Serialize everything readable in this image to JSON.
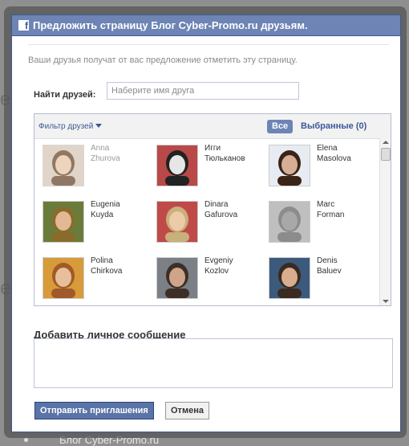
{
  "dialog": {
    "title": "Предложить страницу Блог Cyber-Promo.ru друзьям.",
    "intro": "Ваши друзья получат от вас предложение отметить эту страницу.",
    "find_label": "Найти друзей:",
    "find_placeholder": "Наберите имя друга",
    "filter_label": "Фильтр друзей",
    "tab_all": "Все",
    "tab_selected": "Выбранные (0)",
    "message_label": "Добавить личное сообщение",
    "send_button": "Отправить приглашения",
    "cancel_button": "Отмена"
  },
  "friends": [
    {
      "first": "Anna",
      "last": "Zhurova",
      "dim": true,
      "colors": {
        "bg": "#d8c8b8",
        "hair": "#6b4a2f",
        "face": "#e8c6a8"
      }
    },
    {
      "first": "Игги",
      "last": "Тюльканов",
      "colors": {
        "bg": "#b94848",
        "hair": "#222222",
        "face": "#e6e6e6"
      }
    },
    {
      "first": "Elena",
      "last": "Masolova",
      "colors": {
        "bg": "#e7ecf2",
        "hair": "#3a2418",
        "face": "#d6ae95"
      }
    },
    {
      "first": "Eugenia",
      "last": "Kuyda",
      "colors": {
        "bg": "#6b7c3a",
        "hair": "#8a6b2b",
        "face": "#e2b994"
      }
    },
    {
      "first": "Dinara",
      "last": "Gafurova",
      "colors": {
        "bg": "#c04a4a",
        "hair": "#c8b07a",
        "face": "#edcaa8"
      }
    },
    {
      "first": "Marc",
      "last": "Forman",
      "colors": {
        "bg": "#bfbfbf",
        "hair": "#8c8c8c",
        "face": "#a8a8a8"
      }
    },
    {
      "first": "Polina",
      "last": "Chirkova",
      "colors": {
        "bg": "#d89b3a",
        "hair": "#a05a2a",
        "face": "#e7c09b"
      }
    },
    {
      "first": "Evgeniy",
      "last": "Kozlov",
      "colors": {
        "bg": "#7b7f86",
        "hair": "#3b2f27",
        "face": "#cfa488"
      }
    },
    {
      "first": "Denis",
      "last": "Baluev",
      "colors": {
        "bg": "#3c5a7c",
        "hair": "#3b2a20",
        "face": "#d9ae8e"
      }
    }
  ],
  "background": {
    "bottom_text": "Блог Cyber-Promo.ru"
  }
}
